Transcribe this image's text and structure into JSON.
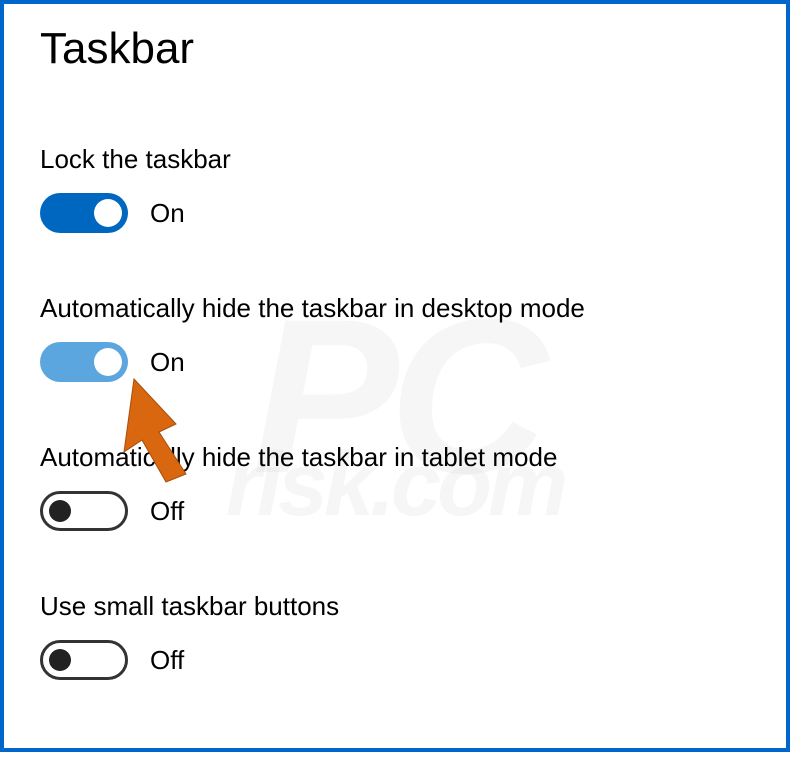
{
  "page": {
    "title": "Taskbar"
  },
  "settings": [
    {
      "label": "Lock the taskbar",
      "state_text": "On",
      "enabled": true,
      "variant": "on-dark"
    },
    {
      "label": "Automatically hide the taskbar in desktop mode",
      "state_text": "On",
      "enabled": true,
      "variant": "on-light"
    },
    {
      "label": "Automatically hide the taskbar in tablet mode",
      "state_text": "Off",
      "enabled": false,
      "variant": "off"
    },
    {
      "label": "Use small taskbar buttons",
      "state_text": "Off",
      "enabled": false,
      "variant": "off"
    }
  ],
  "watermark": {
    "main": "PC",
    "sub": "risk.com"
  }
}
